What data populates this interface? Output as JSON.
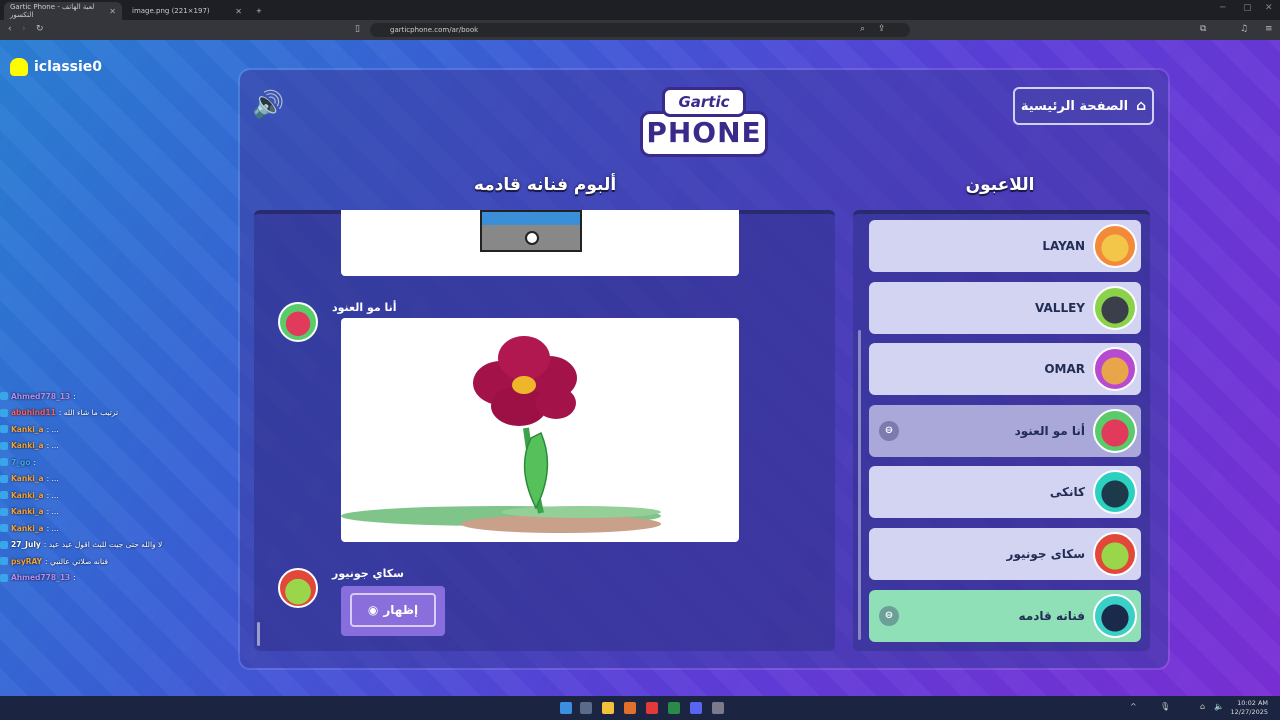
{
  "browser": {
    "tabs": [
      {
        "title": "Gartic Phone - لعبة الهاتف التكسور",
        "active": true
      },
      {
        "title": "image.png (221×197)",
        "active": false
      }
    ],
    "url": "garticphone.com/ar/book"
  },
  "overlay": {
    "streamer": "iclassie0",
    "chat": [
      {
        "name": "Ahmed778_13",
        "msg": ":",
        "color": "#b48cf0"
      },
      {
        "name": "abuhind11",
        "msg": ": ترتيب ما شاء الله",
        "color": "#ff5a5a"
      },
      {
        "name": "Kanki_a",
        "msg": ": ...",
        "color": "#f2a23a"
      },
      {
        "name": "Kanki_a",
        "msg": ": ...",
        "color": "#f2a23a"
      },
      {
        "name": "7_go",
        "msg": ":",
        "color": "#3aa8f0"
      },
      {
        "name": "Kanki_a",
        "msg": ": ...",
        "color": "#f2a23a"
      },
      {
        "name": "Kanki_a",
        "msg": ": ...",
        "color": "#f2a23a"
      },
      {
        "name": "Kanki_a",
        "msg": ": ...",
        "color": "#f2a23a"
      },
      {
        "name": "Kanki_a",
        "msg": ": ...",
        "color": "#f2a23a"
      },
      {
        "name": "27_July",
        "msg": ": لا والله حتى جيت للبث اقول عيد عيد",
        "color": "#ffffff"
      },
      {
        "name": "psyRAY",
        "msg": ": فنانه صلاتي عالنبي",
        "color": "#f2a23a"
      },
      {
        "name": "Ahmed778_13",
        "msg": ":",
        "color": "#b48cf0"
      }
    ]
  },
  "game": {
    "logo_top": "Gartic",
    "logo_bottom": "PHONE",
    "home_label": "الصفحة الرئيسية",
    "album_title": "ألبوم فنانه قادمه",
    "players_title": "اللاعبون",
    "entries": [
      {
        "author": "أنا مو العنود"
      },
      {
        "author": "سكاي جونيور"
      }
    ],
    "reveal_label": "إظهار",
    "players": [
      {
        "name": "LAYAN",
        "avatar": "pizza-avatar",
        "state": "normal"
      },
      {
        "name": "VALLEY",
        "avatar": "bomb-avatar",
        "state": "normal"
      },
      {
        "name": "OMAR",
        "avatar": "tiki-avatar",
        "state": "normal"
      },
      {
        "name": "أنا مو العنود",
        "avatar": "strawberry-avatar",
        "state": "dim"
      },
      {
        "name": "كانكى",
        "avatar": "ghost-avatar",
        "state": "normal"
      },
      {
        "name": "سكاى جونيور",
        "avatar": "cactus-avatar",
        "state": "normal"
      },
      {
        "name": "فنانه قادمه",
        "avatar": "dark-avatar",
        "state": "active"
      }
    ]
  },
  "taskbar": {
    "time": "10:02 AM",
    "date": "12/27/2025"
  }
}
